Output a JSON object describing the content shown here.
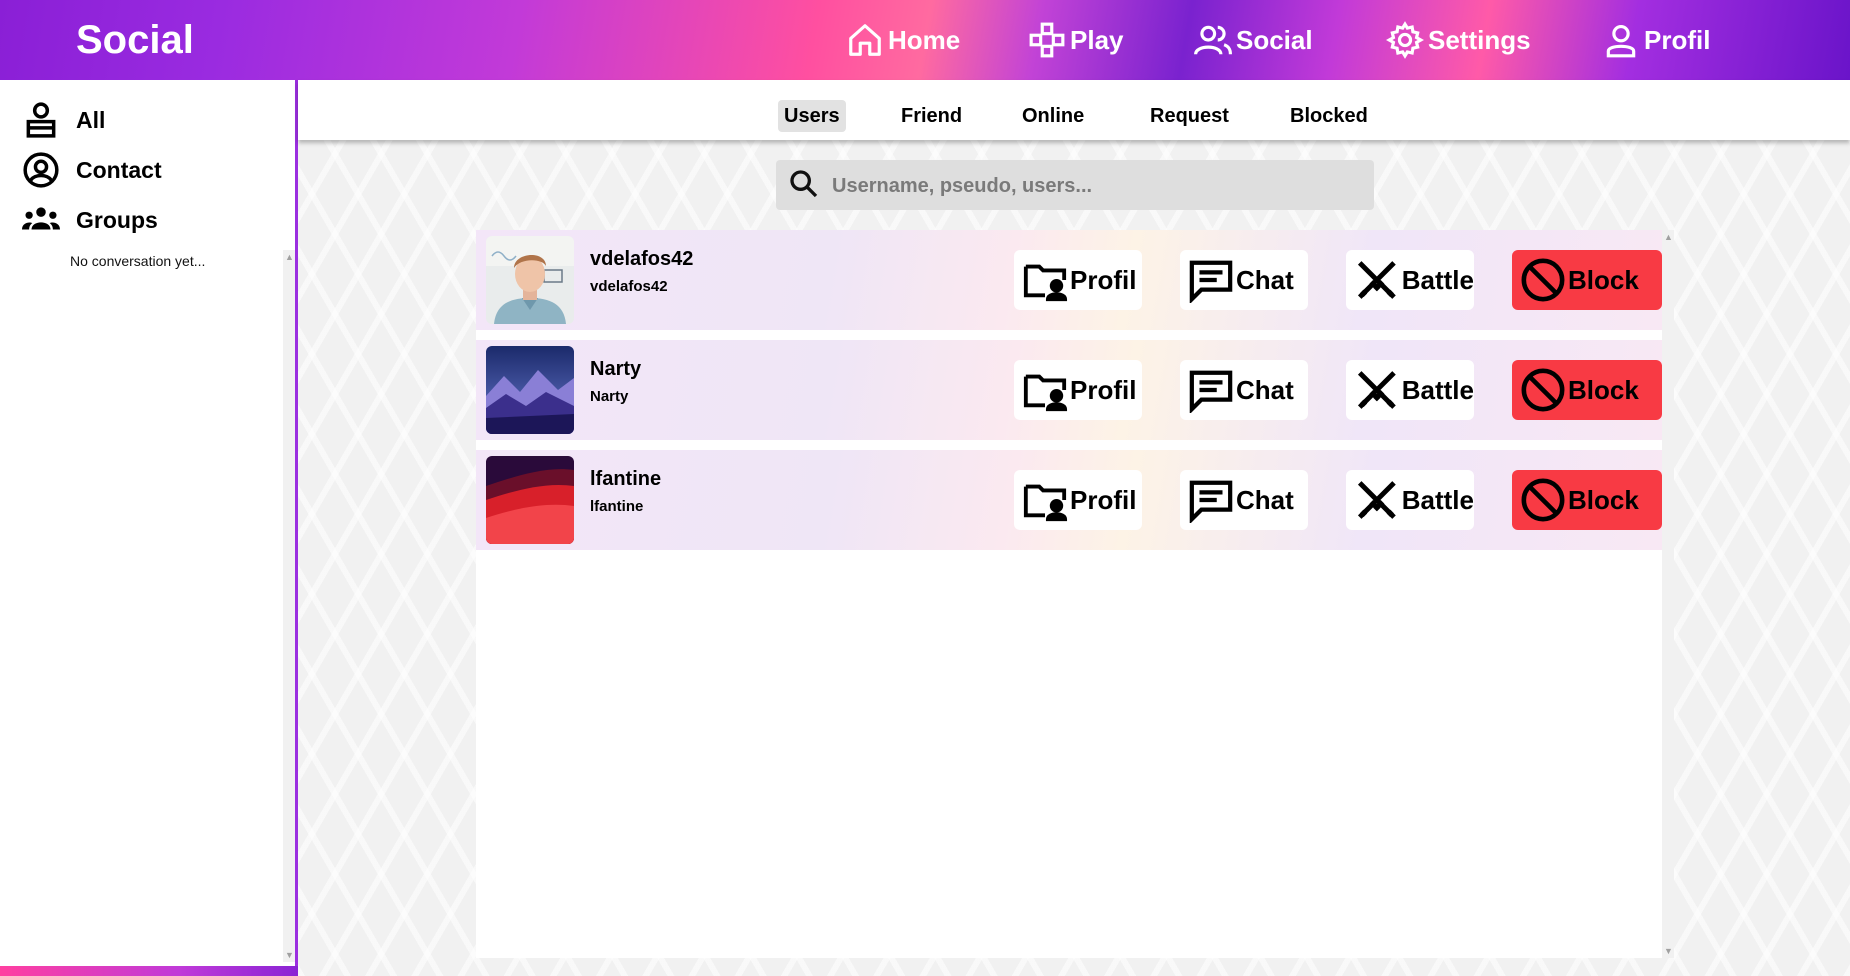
{
  "app": {
    "title": "Social"
  },
  "nav": [
    {
      "label": "Home",
      "icon": "home-icon"
    },
    {
      "label": "Play",
      "icon": "gamepad-icon"
    },
    {
      "label": "Social",
      "icon": "users-icon"
    },
    {
      "label": "Settings",
      "icon": "gear-icon"
    },
    {
      "label": "Profil",
      "icon": "user-icon"
    }
  ],
  "sidebar": {
    "items": [
      {
        "label": "All",
        "icon": "person-bust-icon"
      },
      {
        "label": "Contact",
        "icon": "account-circle-icon"
      },
      {
        "label": "Groups",
        "icon": "group-icon"
      }
    ],
    "empty_text": "No conversation yet..."
  },
  "tabs": [
    {
      "label": "Users",
      "active": true
    },
    {
      "label": "Friend",
      "active": false
    },
    {
      "label": "Online",
      "active": false
    },
    {
      "label": "Request",
      "active": false
    },
    {
      "label": "Blocked",
      "active": false
    }
  ],
  "search": {
    "placeholder": "Username, pseudo, users...",
    "value": ""
  },
  "actions": {
    "profil": "Profil",
    "chat": "Chat",
    "battle": "Battle",
    "block": "Block"
  },
  "users": [
    {
      "name": "vdelafos42",
      "pseudo": "vdelafos42",
      "avatar": "portrait-photo"
    },
    {
      "name": "Narty",
      "pseudo": "Narty",
      "avatar": "mountain-landscape"
    },
    {
      "name": "lfantine",
      "pseudo": "lfantine",
      "avatar": "red-wave-abstract"
    }
  ],
  "colors": {
    "accent": "#9b2fe0",
    "block": "#f83a44",
    "nav_gradient_start": "#8a1fd6",
    "nav_gradient_pink": "#ff4fa0"
  }
}
